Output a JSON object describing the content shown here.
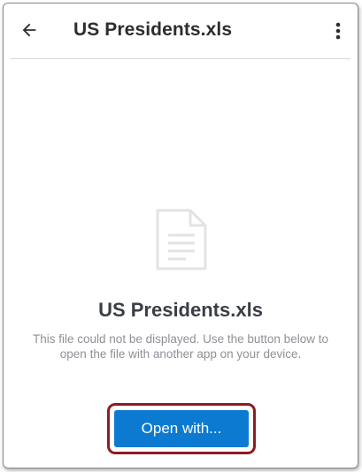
{
  "toolbar": {
    "title": "US Presidents.xls"
  },
  "preview": {
    "file_name": "US Presidents.xls",
    "message": "This file could not be displayed. Use the button below to open the file with another app on your device.",
    "open_with_label": "Open with..."
  },
  "icons": {
    "back": "arrow-left-icon",
    "menu": "more-vertical-icon",
    "file": "document-icon"
  },
  "colors": {
    "primary_button": "#0d7ad2",
    "highlight_outline": "#8b1d22",
    "title_text": "#2d2d2d",
    "message_text": "#8d9196"
  }
}
